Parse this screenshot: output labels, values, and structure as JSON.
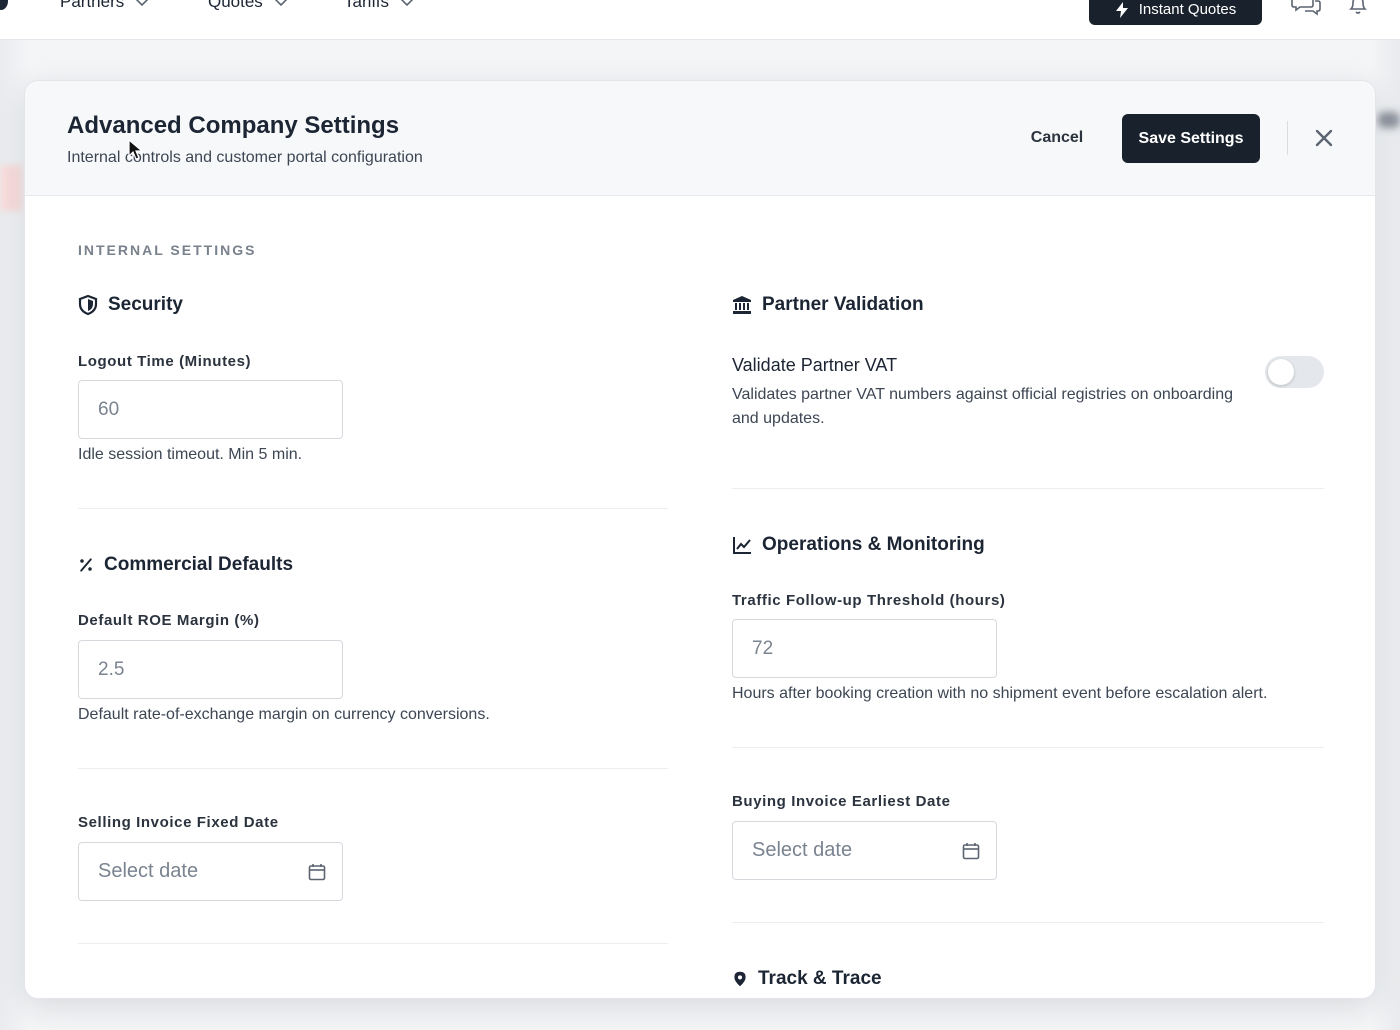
{
  "topnav": {
    "items": [
      {
        "label": "Partners"
      },
      {
        "label": "Quotes"
      },
      {
        "label": "Tariffs"
      }
    ],
    "instant_quotes_label": "Instant Quotes",
    "icons": [
      "chat-icon",
      "bell-icon"
    ]
  },
  "modal": {
    "title": "Advanced Company Settings",
    "subtitle": "Internal controls and customer portal configuration",
    "cancel_label": "Cancel",
    "save_label": "Save Settings",
    "section_label": "INTERNAL SETTINGS",
    "security": {
      "title": "Security",
      "icon": "shield-icon",
      "logout_label": "Logout Time (Minutes)",
      "logout_placeholder": "60",
      "logout_help": "Idle session timeout. Min 5 min."
    },
    "commercial": {
      "title": "Commercial Defaults",
      "icon": "percent-icon",
      "roe_label": "Default ROE Margin (%)",
      "roe_placeholder": "2.5",
      "roe_help": "Default rate-of-exchange margin on currency conversions.",
      "selling_date_label": "Selling Invoice Fixed Date",
      "selling_date_placeholder": "Select date"
    },
    "partner_validation": {
      "title": "Partner Validation",
      "icon": "bank-icon",
      "toggle_title": "Validate Partner VAT",
      "toggle_desc": "Validates partner VAT numbers against official registries on onboarding and updates.",
      "toggle_on": false
    },
    "operations": {
      "title": "Operations & Monitoring",
      "icon": "chart-line-icon",
      "threshold_label": "Traffic Follow-up Threshold (hours)",
      "threshold_placeholder": "72",
      "threshold_help": "Hours after booking creation with no shipment event before escalation alert.",
      "buying_date_label": "Buying Invoice Earliest Date",
      "buying_date_placeholder": "Select date"
    },
    "track_trace": {
      "title": "Track & Trace",
      "icon": "map-pin-icon"
    }
  },
  "colors": {
    "primary_dark": "#19222c",
    "text": "#1c2533",
    "muted": "#79818c",
    "toggle_off": "#e4e7eb"
  }
}
